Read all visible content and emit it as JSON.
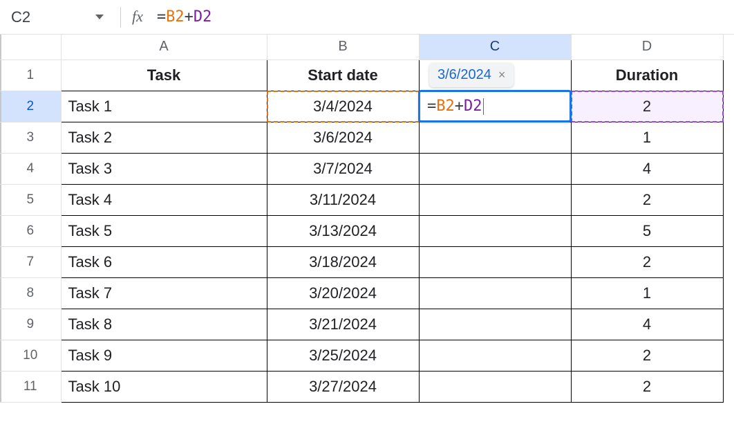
{
  "namebox": {
    "value": "C2"
  },
  "formula": {
    "raw": "=B2+D2",
    "tokens": {
      "eq": "=",
      "ref1": "B2",
      "plus": "+",
      "ref2": "D2"
    }
  },
  "editcell": {
    "tokens": {
      "eq": "=",
      "ref1": "B2",
      "plus": "+",
      "ref2": "D2"
    }
  },
  "preview": {
    "value": "3/6/2024"
  },
  "columns": {
    "A": "A",
    "B": "B",
    "C": "C",
    "D": "D"
  },
  "headers": {
    "A": "Task",
    "B": "Start date",
    "C": "",
    "D": "Duration"
  },
  "rows": [
    {
      "n": "1"
    },
    {
      "n": "2",
      "A": "Task 1",
      "B": "3/4/2024",
      "D": "2"
    },
    {
      "n": "3",
      "A": "Task 2",
      "B": "3/6/2024",
      "D": "1"
    },
    {
      "n": "4",
      "A": "Task 3",
      "B": "3/7/2024",
      "D": "4"
    },
    {
      "n": "5",
      "A": "Task 4",
      "B": "3/11/2024",
      "D": "2"
    },
    {
      "n": "6",
      "A": "Task 5",
      "B": "3/13/2024",
      "D": "5"
    },
    {
      "n": "7",
      "A": "Task 6",
      "B": "3/18/2024",
      "D": "2"
    },
    {
      "n": "8",
      "A": "Task 7",
      "B": "3/20/2024",
      "D": "1"
    },
    {
      "n": "9",
      "A": "Task 8",
      "B": "3/21/2024",
      "D": "4"
    },
    {
      "n": "10",
      "A": "Task 9",
      "B": "3/25/2024",
      "D": "2"
    },
    {
      "n": "11",
      "A": "Task 10",
      "B": "3/27/2024",
      "D": "2"
    }
  ],
  "colors": {
    "ref_orange": "#e8710a",
    "ref_purple": "#a142f4",
    "selection_blue": "#1a73e8",
    "header_sel_bg": "#d3e3fd"
  }
}
